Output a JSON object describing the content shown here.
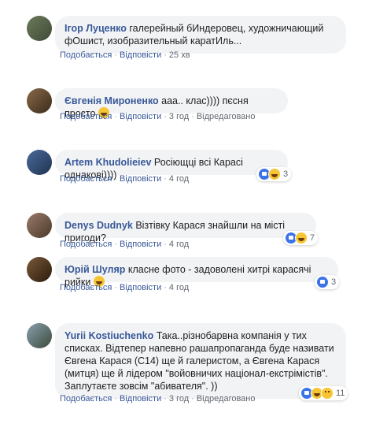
{
  "actions": {
    "like": "Подобається",
    "reply": "Відповісти",
    "edited": "Відредаговано",
    "dot": "·"
  },
  "comments": [
    {
      "author": "Ігор Луценко",
      "text": " галерейный бИндеровец, художничающий фОшист, изобразительный каратИль...",
      "time": "25 хв"
    },
    {
      "author": "Євгенія Мироненко",
      "text": " ааа.. клас)))) пєсня просто ",
      "time": "3 год",
      "emoji": "laugh-emoji"
    },
    {
      "author": "Artem Khudolieiev",
      "text": " Росіющці всі Карасі однакові))))",
      "time": "4 год",
      "reactions": [
        "like",
        "haha"
      ],
      "count": "3"
    },
    {
      "author": "Denys Dudnyk",
      "text": " Візтівку Карася знайшли на місті пригоди?",
      "time": "4 год",
      "reactions": [
        "like",
        "haha"
      ],
      "count": "7"
    },
    {
      "author": "Юрій Шуляр",
      "text": " класне фото - задоволені хитрі карасячі рийки ",
      "time": "4 год",
      "emoji": "smile-emoji",
      "reactions": [
        "like"
      ],
      "count": "3"
    },
    {
      "author": "Yurii Kostiuchenko",
      "text": " Така..різнобарвна компанія у тих списках. Відтепер напевно рашапропаганда буде називати Євгена Карася (С14) ще й галеристом, а Євгена Карася (митця) ще й лідером \"войовничих націонал-екстрімістів\". Заплутаєте зовсім \"абивателя\". ))",
      "time": "3 год",
      "reactions": [
        "like",
        "haha",
        "sad"
      ],
      "count": "11"
    }
  ],
  "colors": {
    "link": "#385898",
    "bubble": "#f2f3f5",
    "text": "#1c1e21",
    "meta": "#606770"
  }
}
